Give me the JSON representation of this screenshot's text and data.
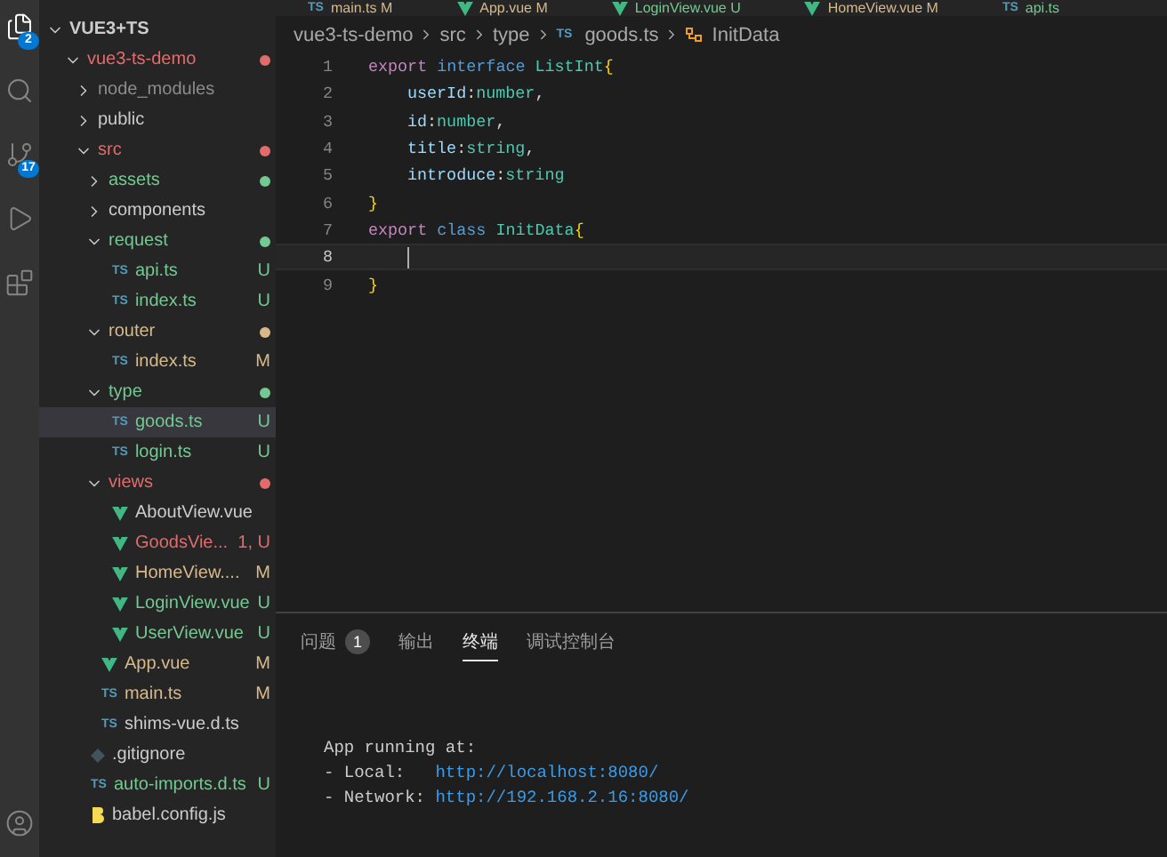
{
  "activity_bar": {
    "items": [
      {
        "kind": "explorer",
        "badge": "2",
        "selected": true
      },
      {
        "kind": "search",
        "selected": false
      },
      {
        "kind": "source-control",
        "badge": "17",
        "selected": false
      },
      {
        "kind": "run",
        "selected": false
      },
      {
        "kind": "extensions",
        "selected": false
      }
    ],
    "bottom": [
      {
        "kind": "account"
      }
    ]
  },
  "editor_tabs": [
    {
      "label": "main.ts",
      "status": "M",
      "kind": "ts",
      "icon_label": "TS",
      "color": "#d7b98a"
    },
    {
      "label": "App.vue",
      "status": "M",
      "kind": "vue",
      "color": "#d7b98a"
    },
    {
      "label": "LoginView.vue",
      "status": "U",
      "kind": "vue",
      "color": "#73c991"
    },
    {
      "label": "HomeView.vue",
      "status": "M",
      "kind": "vue",
      "color": "#d7b98a"
    },
    {
      "label": "api.ts",
      "kind": "ts",
      "icon_label": "TS",
      "color": "#73c991"
    }
  ],
  "explorer": {
    "root": {
      "label": "VUE3+TS",
      "expanded": true
    },
    "tree": [
      {
        "label": "vue3-ts-demo",
        "kind": "folder",
        "expanded": true,
        "color": "#e06c6c",
        "dot": true,
        "children": [
          {
            "label": "node_modules",
            "kind": "folder",
            "expanded": false,
            "color": "#8c8c8c"
          },
          {
            "label": "public",
            "kind": "folder",
            "expanded": false,
            "color": "#cccccc"
          },
          {
            "label": "src",
            "kind": "folder",
            "expanded": true,
            "color": "#e06c6c",
            "dot": true,
            "children": [
              {
                "label": "assets",
                "kind": "folder",
                "expanded": false,
                "color": "#73c991",
                "dot": true
              },
              {
                "label": "components",
                "kind": "folder",
                "expanded": false,
                "color": "#cccccc"
              },
              {
                "label": "request",
                "kind": "folder",
                "expanded": true,
                "color": "#73c991",
                "dot": true,
                "children": [
                  {
                    "label": "api.ts",
                    "kind": "ts",
                    "icon_label": "TS",
                    "color": "#73c991",
                    "status": "U",
                    "selected": false
                  },
                  {
                    "label": "index.ts",
                    "kind": "ts",
                    "icon_label": "TS",
                    "color": "#73c991",
                    "status": "U",
                    "selected": false
                  }
                ]
              },
              {
                "label": "router",
                "kind": "folder",
                "expanded": true,
                "color": "#d7b98a",
                "dot": true,
                "children": [
                  {
                    "label": "index.ts",
                    "kind": "ts",
                    "icon_label": "TS",
                    "color": "#d7b98a",
                    "status": "M",
                    "selected": false
                  }
                ]
              },
              {
                "label": "type",
                "kind": "folder",
                "expanded": true,
                "color": "#73c991",
                "dot": true,
                "children": [
                  {
                    "label": "goods.ts",
                    "kind": "ts",
                    "icon_label": "TS",
                    "color": "#73c991",
                    "status": "U",
                    "selected": true
                  },
                  {
                    "label": "login.ts",
                    "kind": "ts",
                    "icon_label": "TS",
                    "color": "#73c991",
                    "status": "U",
                    "selected": false
                  }
                ]
              },
              {
                "label": "views",
                "kind": "folder",
                "expanded": true,
                "color": "#e06c6c",
                "dot": true,
                "children": [
                  {
                    "label": "AboutView.vue",
                    "kind": "vue",
                    "color": "#cccccc",
                    "selected": false
                  },
                  {
                    "label": "GoodsVie...",
                    "kind": "vue",
                    "color": "#e06c6c",
                    "status": "1, U",
                    "selected": false
                  },
                  {
                    "label": "HomeView....",
                    "kind": "vue",
                    "color": "#d7b98a",
                    "status": "M",
                    "selected": false
                  },
                  {
                    "label": "LoginView.vue",
                    "kind": "vue",
                    "color": "#73c991",
                    "status": "U",
                    "selected": false
                  },
                  {
                    "label": "UserView.vue",
                    "kind": "vue",
                    "color": "#73c991",
                    "status": "U",
                    "selected": false
                  }
                ]
              },
              {
                "label": "App.vue",
                "kind": "vue",
                "color": "#d7b98a",
                "status": "M",
                "selected": false
              },
              {
                "label": "main.ts",
                "kind": "ts",
                "icon_label": "TS",
                "color": "#d7b98a",
                "status": "M",
                "selected": false
              },
              {
                "label": "shims-vue.d.ts",
                "kind": "ts",
                "icon_label": "TS",
                "color": "#cccccc",
                "selected": false
              }
            ]
          },
          {
            "label": ".gitignore",
            "kind": "git",
            "color": "#cccccc",
            "selected": false
          },
          {
            "label": "auto-imports.d.ts",
            "kind": "ts",
            "icon_label": "TS",
            "color": "#73c991",
            "status": "U",
            "selected": false
          },
          {
            "label": "babel.config.js",
            "kind": "babel",
            "color": "#cccccc",
            "selected": false
          }
        ]
      }
    ]
  },
  "breadcrumbs": [
    {
      "label": "vue3-ts-demo",
      "kind": "folder"
    },
    {
      "label": "src",
      "kind": "folder"
    },
    {
      "label": "type",
      "kind": "folder"
    },
    {
      "label": "goods.ts",
      "kind": "ts",
      "icon_label": "TS"
    },
    {
      "label": "InitData",
      "kind": "class"
    }
  ],
  "code": [
    {
      "number": "1",
      "current": false,
      "indented": false,
      "tokens": [
        {
          "t": "export ",
          "color": "#c586c0"
        },
        {
          "t": "interface ",
          "color": "#569cd6"
        },
        {
          "t": "ListInt",
          "color": "#4ec9b0"
        },
        {
          "t": "{",
          "color": "#ffd700"
        }
      ]
    },
    {
      "number": "2",
      "current": false,
      "indented": true,
      "tokens": [
        {
          "t": "userId",
          "color": "#9cdcfe"
        },
        {
          "t": ":",
          "color": "#d4d4d4"
        },
        {
          "t": "number",
          "color": "#4ec9b0"
        },
        {
          "t": ",",
          "color": "#d4d4d4"
        }
      ]
    },
    {
      "number": "3",
      "current": false,
      "indented": true,
      "tokens": [
        {
          "t": "id",
          "color": "#9cdcfe"
        },
        {
          "t": ":",
          "color": "#d4d4d4"
        },
        {
          "t": "number",
          "color": "#4ec9b0"
        },
        {
          "t": ",",
          "color": "#d4d4d4"
        }
      ]
    },
    {
      "number": "4",
      "current": false,
      "indented": true,
      "tokens": [
        {
          "t": "title",
          "color": "#9cdcfe"
        },
        {
          "t": ":",
          "color": "#d4d4d4"
        },
        {
          "t": "string",
          "color": "#4ec9b0"
        },
        {
          "t": ",",
          "color": "#d4d4d4"
        }
      ]
    },
    {
      "number": "5",
      "current": false,
      "indented": true,
      "tokens": [
        {
          "t": "introduce",
          "color": "#9cdcfe"
        },
        {
          "t": ":",
          "color": "#d4d4d4"
        },
        {
          "t": "string",
          "color": "#4ec9b0"
        }
      ]
    },
    {
      "number": "6",
      "current": false,
      "indented": false,
      "tokens": [
        {
          "t": "}",
          "color": "#ffd700"
        }
      ]
    },
    {
      "number": "7",
      "current": false,
      "indented": false,
      "tokens": [
        {
          "t": "export ",
          "color": "#c586c0"
        },
        {
          "t": "class ",
          "color": "#569cd6"
        },
        {
          "t": "InitData",
          "color": "#4ec9b0"
        },
        {
          "t": "{",
          "color": "#ffd700"
        }
      ]
    },
    {
      "number": "8",
      "current": true,
      "indented": true
    },
    {
      "number": "9",
      "current": false,
      "indented": false,
      "tokens": [
        {
          "t": "}",
          "color": "#ffd700"
        }
      ]
    }
  ],
  "panel": {
    "tabs": [
      {
        "label": "问题",
        "badge": "1",
        "selected": false
      },
      {
        "label": "输出",
        "selected": false
      },
      {
        "label": "终端",
        "selected": true
      },
      {
        "label": "调试控制台",
        "selected": false
      }
    ],
    "terminal": [
      {
        "parts": [
          {
            "t": "App running at:",
            "link": false
          }
        ]
      },
      {
        "parts": [
          {
            "t": "- Local:   ",
            "link": false
          },
          {
            "t": "http://localhost:8080/",
            "link": true
          }
        ]
      },
      {
        "parts": [
          {
            "t": "- Network: ",
            "link": false
          },
          {
            "t": "http://192.168.2.16:8080/",
            "link": true
          }
        ]
      }
    ]
  }
}
